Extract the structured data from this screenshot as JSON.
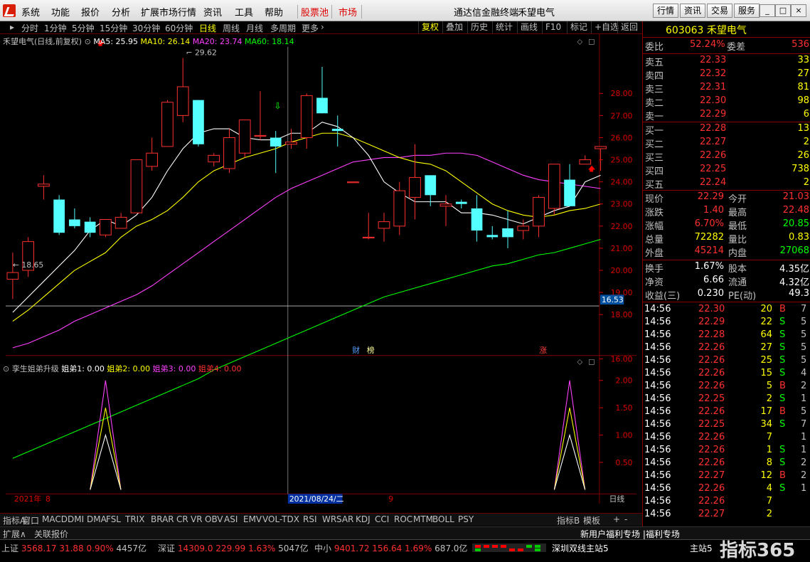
{
  "app_title": "通达信金融终端",
  "stock_title": "禾望电气",
  "menu": [
    "系统",
    "功能",
    "报价",
    "分析",
    "扩展市场行情",
    "资讯",
    "工具",
    "帮助"
  ],
  "menu_red": [
    "股票池",
    "市场"
  ],
  "right_buttons": [
    "行情",
    "资讯",
    "交易",
    "服务"
  ],
  "periods": [
    "分时",
    "1分钟",
    "5分钟",
    "15分钟",
    "30分钟",
    "60分钟",
    "日线",
    "周线",
    "月线",
    "多周期",
    "更多"
  ],
  "active_period": "日线",
  "tools": [
    "复权",
    "叠加",
    "历史",
    "统计",
    "画线",
    "F10",
    "标记",
    "+自选",
    "返回"
  ],
  "chart_header": {
    "name": "禾望电气(日线,前复权)",
    "ma5": "MA5: 25.95",
    "ma10": "MA10: 26.14",
    "ma20": "MA20: 23.74",
    "ma60": "MA60: 18.14"
  },
  "indicator_header": {
    "name": "孪生姐弟升级",
    "s1": "姐弟1: 0.00",
    "s2": "姐弟2: 0.00",
    "s3": "姐弟3: 0.00",
    "s4": "姐弟4: 0.00"
  },
  "price_axis": [
    "28.00",
    "27.00",
    "26.00",
    "25.00",
    "24.00",
    "23.00",
    "22.00",
    "21.00",
    "20.00",
    "19.00",
    "18.00",
    "16.00"
  ],
  "ind_axis": [
    "2.00",
    "1.50",
    "1.00",
    "0.50"
  ],
  "price_marker": "16.53",
  "high_label": "29.62",
  "low_label": "18.65",
  "event_tags": [
    "财",
    "榜",
    "涨"
  ],
  "date_labels": {
    "year": "2021年",
    "m8": "8",
    "cursor": "2021/08/24/二",
    "m9": "9",
    "period": "日线"
  },
  "bottom_tabs": [
    "指标A",
    "窗口",
    "MACD",
    "DMI",
    "DMA",
    "FSL",
    "TRIX",
    "BRAR",
    "CR",
    "VR",
    "OBV",
    "ASI",
    "EMV",
    "VOL-TDX",
    "RSI",
    "WR",
    "SAR",
    "KDJ",
    "CCI",
    "ROC",
    "MTM",
    "BOLL",
    "PSY",
    "指标B",
    "模板"
  ],
  "status_left": [
    "扩展∧",
    "关联报价"
  ],
  "status_right": "新用户福利专场 |福利专场",
  "ticker": [
    {
      "name": "上证",
      "price": "3568.17",
      "chg": "31.88",
      "pct": "0.90%",
      "amt": "4457亿"
    },
    {
      "name": "深证",
      "price": "14309.0",
      "chg": "229.99",
      "pct": "1.63%",
      "amt": "5047亿"
    },
    {
      "name": "中小",
      "price": "9401.72",
      "chg": "156.64",
      "pct": "1.69%",
      "amt": "687.0亿"
    }
  ],
  "ticker_right": [
    "深圳双线主站5",
    "主站5"
  ],
  "watermark": "指标365",
  "quote": {
    "code": "603063",
    "name": "禾望电气",
    "weibi_label": "委比",
    "weibi": "52.24%",
    "weicha_label": "委差",
    "weicha": "536",
    "asks": [
      {
        "l": "卖五",
        "p": "22.33",
        "q": "33"
      },
      {
        "l": "卖四",
        "p": "22.32",
        "q": "27"
      },
      {
        "l": "卖三",
        "p": "22.31",
        "q": "81"
      },
      {
        "l": "卖二",
        "p": "22.30",
        "q": "98"
      },
      {
        "l": "卖一",
        "p": "22.29",
        "q": "6"
      }
    ],
    "bids": [
      {
        "l": "买一",
        "p": "22.28",
        "q": "13"
      },
      {
        "l": "买二",
        "p": "22.27",
        "q": "2"
      },
      {
        "l": "买三",
        "p": "22.26",
        "q": "26"
      },
      {
        "l": "买四",
        "p": "22.25",
        "q": "738"
      },
      {
        "l": "买五",
        "p": "22.24",
        "q": "2"
      }
    ],
    "stats": [
      {
        "l1": "现价",
        "v1": "22.29",
        "l2": "今开",
        "v2": "21.03",
        "c1": "red",
        "c2": "red"
      },
      {
        "l1": "涨跌",
        "v1": "1.40",
        "l2": "最高",
        "v2": "22.48",
        "c1": "red",
        "c2": "red"
      },
      {
        "l1": "涨幅",
        "v1": "6.70%",
        "l2": "最低",
        "v2": "20.85",
        "c1": "red",
        "c2": "green"
      },
      {
        "l1": "总量",
        "v1": "72282",
        "l2": "量比",
        "v2": "0.83",
        "c1": "yellow",
        "c2": "yellow"
      },
      {
        "l1": "外盘",
        "v1": "45214",
        "l2": "内盘",
        "v2": "27068",
        "c1": "red",
        "c2": "green"
      }
    ],
    "fund": [
      {
        "l1": "换手",
        "v1": "1.67%",
        "l2": "股本",
        "v2": "4.35亿"
      },
      {
        "l1": "净资",
        "v1": "6.66",
        "l2": "流通",
        "v2": "4.32亿"
      },
      {
        "l1": "收益(三)",
        "v1": "0.230",
        "l2": "PE(动)",
        "v2": "49.3"
      }
    ]
  },
  "ticks": [
    {
      "t": "14:56",
      "p": "22.30",
      "v": "20",
      "f": "B",
      "n": "7"
    },
    {
      "t": "14:56",
      "p": "22.29",
      "v": "22",
      "f": "S",
      "n": "5"
    },
    {
      "t": "14:56",
      "p": "22.28",
      "v": "64",
      "f": "S",
      "n": "5"
    },
    {
      "t": "14:56",
      "p": "22.26",
      "v": "27",
      "f": "S",
      "n": "5"
    },
    {
      "t": "14:56",
      "p": "22.26",
      "v": "25",
      "f": "S",
      "n": "5"
    },
    {
      "t": "14:56",
      "p": "22.26",
      "v": "15",
      "f": "S",
      "n": "4"
    },
    {
      "t": "14:56",
      "p": "22.26",
      "v": "5",
      "f": "B",
      "n": "2"
    },
    {
      "t": "14:56",
      "p": "22.25",
      "v": "2",
      "f": "S",
      "n": "1"
    },
    {
      "t": "14:56",
      "p": "22.26",
      "v": "17",
      "f": "B",
      "n": "5"
    },
    {
      "t": "14:56",
      "p": "22.25",
      "v": "34",
      "f": "S",
      "n": "7"
    },
    {
      "t": "14:56",
      "p": "22.26",
      "v": "7",
      "f": "",
      "n": "1"
    },
    {
      "t": "14:56",
      "p": "22.26",
      "v": "1",
      "f": "S",
      "n": "1"
    },
    {
      "t": "14:56",
      "p": "22.26",
      "v": "8",
      "f": "S",
      "n": "2"
    },
    {
      "t": "14:56",
      "p": "22.27",
      "v": "12",
      "f": "B",
      "n": "2"
    },
    {
      "t": "14:56",
      "p": "22.26",
      "v": "4",
      "f": "S",
      "n": "1"
    },
    {
      "t": "14:56",
      "p": "22.26",
      "v": "7",
      "f": "",
      "n": ""
    },
    {
      "t": "14:56",
      "p": "22.27",
      "v": "2",
      "f": "",
      "n": ""
    }
  ],
  "colors": {
    "up": "#ff3030",
    "down": "#54ffff",
    "ma5": "#ffffff",
    "ma10": "#ffff00",
    "ma20": "#ff40ff",
    "ma60": "#00ff00",
    "border": "#800000"
  },
  "chart_data": {
    "type": "candlestick",
    "candles": [
      [
        19.6,
        20.8,
        18.7,
        19.9
      ],
      [
        20.0,
        21.5,
        19.7,
        21.3
      ],
      [
        23.8,
        24.3,
        23.2,
        23.9
      ],
      [
        23.2,
        23.4,
        21.6,
        21.7
      ],
      [
        22.3,
        22.8,
        21.9,
        22.0
      ],
      [
        22.2,
        22.4,
        21.5,
        21.7
      ],
      [
        21.6,
        22.3,
        21.5,
        22.3
      ],
      [
        21.9,
        22.6,
        21.9,
        22.4
      ],
      [
        22.6,
        25.0,
        22.6,
        25.0
      ],
      [
        24.7,
        26.0,
        24.5,
        25.3
      ],
      [
        25.6,
        27.7,
        25.6,
        27.6
      ],
      [
        27.0,
        29.6,
        26.7,
        28.3
      ],
      [
        27.7,
        27.7,
        25.6,
        25.7
      ],
      [
        24.9,
        25.3,
        24.7,
        25.2
      ],
      [
        24.6,
        26.4,
        24.4,
        26.0
      ],
      [
        25.3,
        26.8,
        25.1,
        26.8
      ],
      [
        26.1,
        28.1,
        25.9,
        26.1
      ],
      [
        26.0,
        26.3,
        24.4,
        25.6
      ],
      [
        25.7,
        26.4,
        25.5,
        25.8
      ],
      [
        26.0,
        28.0,
        25.5,
        27.9
      ],
      [
        27.8,
        29.2,
        27.1,
        27.1
      ],
      [
        26.4,
        27.0,
        25.6,
        26.3
      ],
      [
        24.0,
        24.0,
        24.0,
        24.0
      ],
      [
        21.5,
        22.6,
        21.4,
        21.5
      ],
      [
        21.9,
        22.6,
        21.3,
        22.2
      ],
      [
        22.0,
        24.0,
        21.6,
        23.6
      ],
      [
        23.3,
        25.7,
        22.3,
        24.2
      ],
      [
        24.3,
        24.3,
        22.9,
        23.4
      ],
      [
        22.9,
        23.4,
        22.0,
        23.0
      ],
      [
        23.1,
        23.2,
        22.8,
        23.0
      ],
      [
        22.8,
        23.4,
        21.3,
        21.8
      ],
      [
        21.6,
        22.0,
        21.4,
        21.5
      ],
      [
        21.9,
        22.7,
        21.0,
        21.5
      ],
      [
        21.8,
        22.3,
        21.4,
        22.0
      ],
      [
        22.0,
        23.4,
        21.5,
        23.3
      ],
      [
        22.8,
        24.8,
        22.5,
        24.8
      ],
      [
        24.1,
        24.8,
        22.9,
        22.9
      ],
      [
        24.8,
        25.2,
        24.8,
        25.0
      ],
      [
        25.5,
        25.6,
        24.5,
        25.6
      ]
    ],
    "ma5": [
      18.1,
      18.8,
      19.5,
      20.2,
      20.9,
      21.8,
      22.3,
      22.0,
      22.5,
      23.3,
      24.5,
      25.5,
      26.2,
      26.4,
      26.4,
      26.0,
      25.9,
      25.9,
      26.2,
      26.2,
      26.7,
      26.5,
      26.0,
      25.2,
      24.0,
      23.5,
      23.1,
      23.1,
      23.1,
      22.6,
      22.6,
      22.5,
      22.3,
      22.1,
      22.4,
      22.7,
      22.9,
      24.0,
      24.3
    ],
    "ma10": [
      17.7,
      18.2,
      18.8,
      19.4,
      20.0,
      20.4,
      20.8,
      21.5,
      22.0,
      22.3,
      22.7,
      23.3,
      24.0,
      24.5,
      24.8,
      25.1,
      25.3,
      25.5,
      25.8,
      26.0,
      26.2,
      26.2,
      26.0,
      25.7,
      25.4,
      25.1,
      24.9,
      24.8,
      24.5,
      24.0,
      23.5,
      23.0,
      22.7,
      22.5,
      22.4,
      22.5,
      22.7,
      22.8,
      23.0
    ],
    "ma20": [
      16.5,
      16.7,
      17.0,
      17.3,
      17.7,
      18.0,
      18.3,
      18.6,
      18.9,
      19.3,
      19.8,
      20.3,
      20.8,
      21.3,
      21.8,
      22.3,
      22.8,
      23.3,
      23.7,
      24.0,
      24.3,
      24.6,
      24.9,
      25.0,
      25.1,
      25.1,
      25.2,
      25.2,
      25.3,
      25.3,
      25.2,
      24.9,
      24.6,
      24.3,
      24.1,
      24.0,
      23.9,
      23.8,
      23.7
    ],
    "ma60": [
      11.5,
      11.8,
      12.1,
      12.4,
      12.7,
      13.0,
      13.3,
      13.6,
      13.9,
      14.2,
      14.5,
      14.8,
      15.1,
      15.5,
      15.8,
      16.1,
      16.4,
      16.7,
      17.0,
      17.3,
      17.6,
      17.9,
      18.2,
      18.5,
      18.8,
      19.0,
      19.2,
      19.4,
      19.6,
      19.8,
      20.0,
      20.2,
      20.3,
      20.5,
      20.7,
      20.8,
      21.0,
      21.2,
      21.4
    ],
    "signals": [
      {
        "i": 6,
        "v3": 2.0,
        "v2": 1.5,
        "v1": 1.0
      },
      {
        "i": 36,
        "v3": 2.0,
        "v2": 1.5,
        "v1": 1.0
      }
    ],
    "ylim": [
      15.2,
      30.3
    ],
    "ind_ylim": [
      0,
      2.2
    ]
  }
}
